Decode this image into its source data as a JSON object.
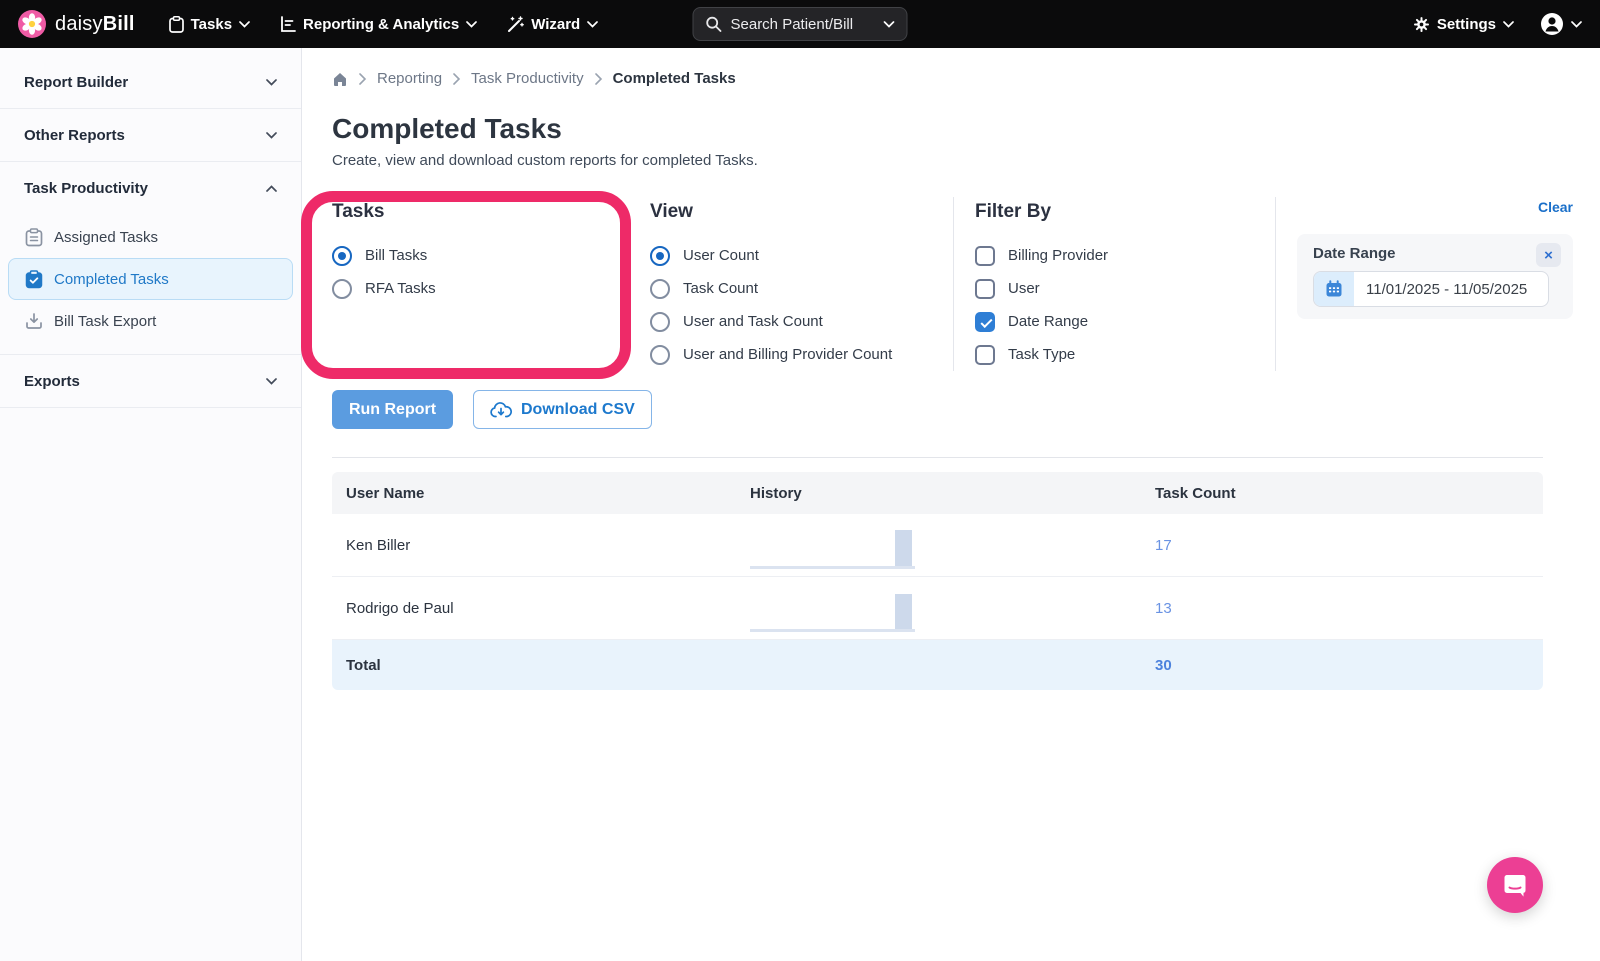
{
  "nav": {
    "brand": {
      "part1": "daisy",
      "part2": "Bill"
    },
    "items": [
      {
        "label": "Tasks"
      },
      {
        "label": "Reporting & Analytics"
      },
      {
        "label": "Wizard"
      }
    ],
    "search": {
      "placeholder": "Search Patient/Bill"
    },
    "settings_label": "Settings"
  },
  "sidebar": {
    "sections": [
      {
        "label": "Report Builder",
        "state": "collapsed"
      },
      {
        "label": "Other Reports",
        "state": "collapsed"
      },
      {
        "label": "Task Productivity",
        "state": "expanded",
        "items": [
          {
            "label": "Assigned Tasks",
            "active": false
          },
          {
            "label": "Completed Tasks",
            "active": true
          },
          {
            "label": "Bill Task Export",
            "active": false
          }
        ]
      },
      {
        "label": "Exports",
        "state": "collapsed"
      }
    ]
  },
  "breadcrumb": {
    "items": [
      "Reporting",
      "Task Productivity",
      "Completed Tasks"
    ]
  },
  "page": {
    "title": "Completed Tasks",
    "subtitle": "Create, view and download custom reports for completed Tasks."
  },
  "tasks_panel": {
    "heading": "Tasks",
    "options": [
      {
        "label": "Bill Tasks",
        "selected": true
      },
      {
        "label": "RFA Tasks",
        "selected": false
      }
    ]
  },
  "view_panel": {
    "heading": "View",
    "options": [
      {
        "label": "User Count",
        "selected": true
      },
      {
        "label": "Task Count",
        "selected": false
      },
      {
        "label": "User and Task Count",
        "selected": false
      },
      {
        "label": "User and Billing Provider Count",
        "selected": false
      }
    ]
  },
  "filter_panel": {
    "heading": "Filter By",
    "options": [
      {
        "label": "Billing Provider",
        "checked": false
      },
      {
        "label": "User",
        "checked": false
      },
      {
        "label": "Date Range",
        "checked": true
      },
      {
        "label": "Task Type",
        "checked": false
      }
    ]
  },
  "date_panel": {
    "clear_label": "Clear",
    "label": "Date Range",
    "value": "11/01/2025 - 11/05/2025",
    "close_glyph": "×"
  },
  "actions": {
    "run_report": "Run Report",
    "download_csv": "Download CSV"
  },
  "results_table": {
    "columns": [
      "User Name",
      "History",
      "Task Count"
    ],
    "rows": [
      {
        "name": "Ken Biller",
        "task_count": "17"
      },
      {
        "name": "Rodrigo de Paul",
        "task_count": "13"
      }
    ],
    "total": {
      "label": "Total",
      "task_count": "30"
    }
  },
  "icons": {
    "logo": "daisy-flower",
    "nav_tasks": "clipboard",
    "nav_reporting": "bar-chart",
    "nav_wizard": "magic-wand",
    "search": "magnifier",
    "settings": "gear",
    "account": "person-circle",
    "breadcrumb_home": "house",
    "assigned_tasks": "clipboard",
    "completed_tasks": "clipboard-check",
    "bill_task_export": "download-tray",
    "download_csv": "cloud-download",
    "date_input": "calendar",
    "chat": "speech-bubble"
  },
  "colors": {
    "accent_blue": "#2079c7",
    "button_blue": "#5b9ce0",
    "link_blue": "#1a6fc9",
    "annotation_pink": "#ee2a68",
    "chat_pink": "#ec3f94",
    "total_row_bg": "#e9f3fc",
    "spark_bar": "#cdd9eb"
  }
}
